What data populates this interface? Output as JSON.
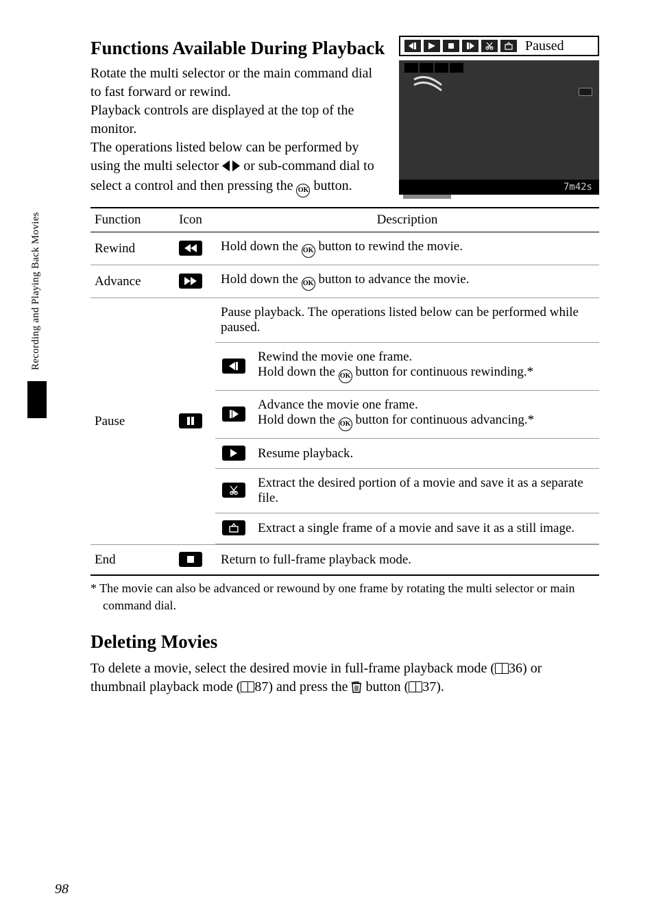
{
  "sidetab": "Recording and Playing Back Movies",
  "title": "Functions Available During Playback",
  "intro_lines": [
    "Rotate the multi selector or the main command dial to fast forward or rewind.",
    "Playback controls are displayed at the top of the monitor.",
    "The operations listed below can be performed by using the multi selector ",
    " or sub-command dial to select a control and then pressing the ",
    " button."
  ],
  "preview_label": "Paused",
  "preview_time": "7m42s",
  "table": {
    "headers": {
      "function": "Function",
      "icon": "Icon",
      "description": "Description"
    },
    "rewind": {
      "label": "Rewind",
      "desc_pre": "Hold down the ",
      "desc_post": " button to rewind the movie."
    },
    "advance": {
      "label": "Advance",
      "desc_pre": "Hold down the ",
      "desc_post": " button to advance the movie."
    },
    "pause": {
      "label": "Pause",
      "header": "Pause playback. The operations listed below can be performed while paused.",
      "r1a": "Rewind the movie one frame.",
      "r1b_pre": "Hold down the ",
      "r1b_post": " button for continuous rewinding.*",
      "r2a": "Advance the movie one frame.",
      "r2b_pre": "Hold down the ",
      "r2b_post": " button for continuous advancing.*",
      "r3": "Resume playback.",
      "r4": "Extract the desired portion of a movie and save it as a separate file.",
      "r5": "Extract a single frame of a movie and save it as a still image."
    },
    "end": {
      "label": "End",
      "desc": "Return to full-frame playback mode."
    }
  },
  "footnote": "*  The movie can also be advanced or rewound by one frame by rotating the multi selector or main command dial.",
  "deleting": {
    "title": "Deleting Movies",
    "pre": "To delete a movie, select the desired movie in full-frame playback mode (",
    "ref1": "36",
    "mid1": ") or thumbnail playback mode (",
    "ref2": "87",
    "mid2": ") and press the ",
    "post": " button (",
    "ref3": "37",
    "end": ")."
  },
  "page_number": "98"
}
